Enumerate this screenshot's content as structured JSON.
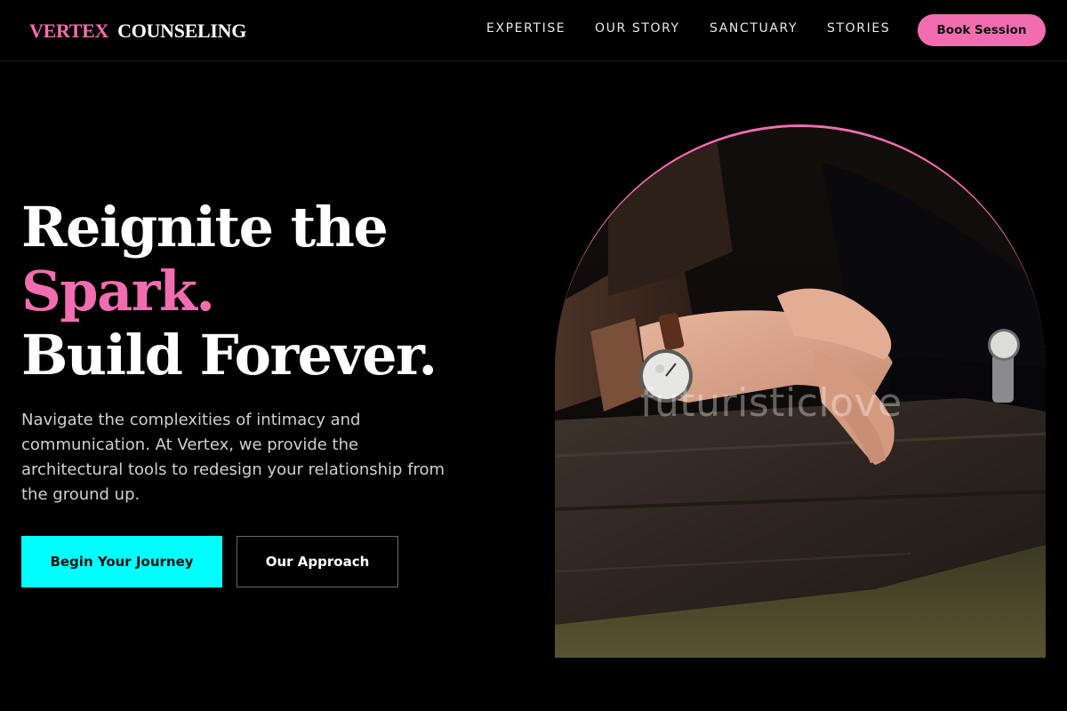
{
  "brand": {
    "part1": "VERTEX",
    "part2": "COUNSELING",
    "accent": "#f26db0"
  },
  "nav": {
    "items": [
      {
        "label": "EXPERTISE"
      },
      {
        "label": "OUR STORY"
      },
      {
        "label": "SANCTUARY"
      },
      {
        "label": "STORIES"
      }
    ],
    "cta": "Book Session"
  },
  "hero": {
    "headline_line1": "Reignite the",
    "headline_line2": "Spark.",
    "headline_line3": "Build Forever.",
    "description": "Navigate the complexities of intimacy and communication. At Vertex, we provide the architectural tools to redesign your relationship from the ground up.",
    "primary_button": "Begin Your Journey",
    "secondary_button": "Our Approach",
    "image_watermark": "futuristiclove"
  },
  "colors": {
    "background": "#000000",
    "pink": "#f26db0",
    "cyan": "#00ffff"
  }
}
